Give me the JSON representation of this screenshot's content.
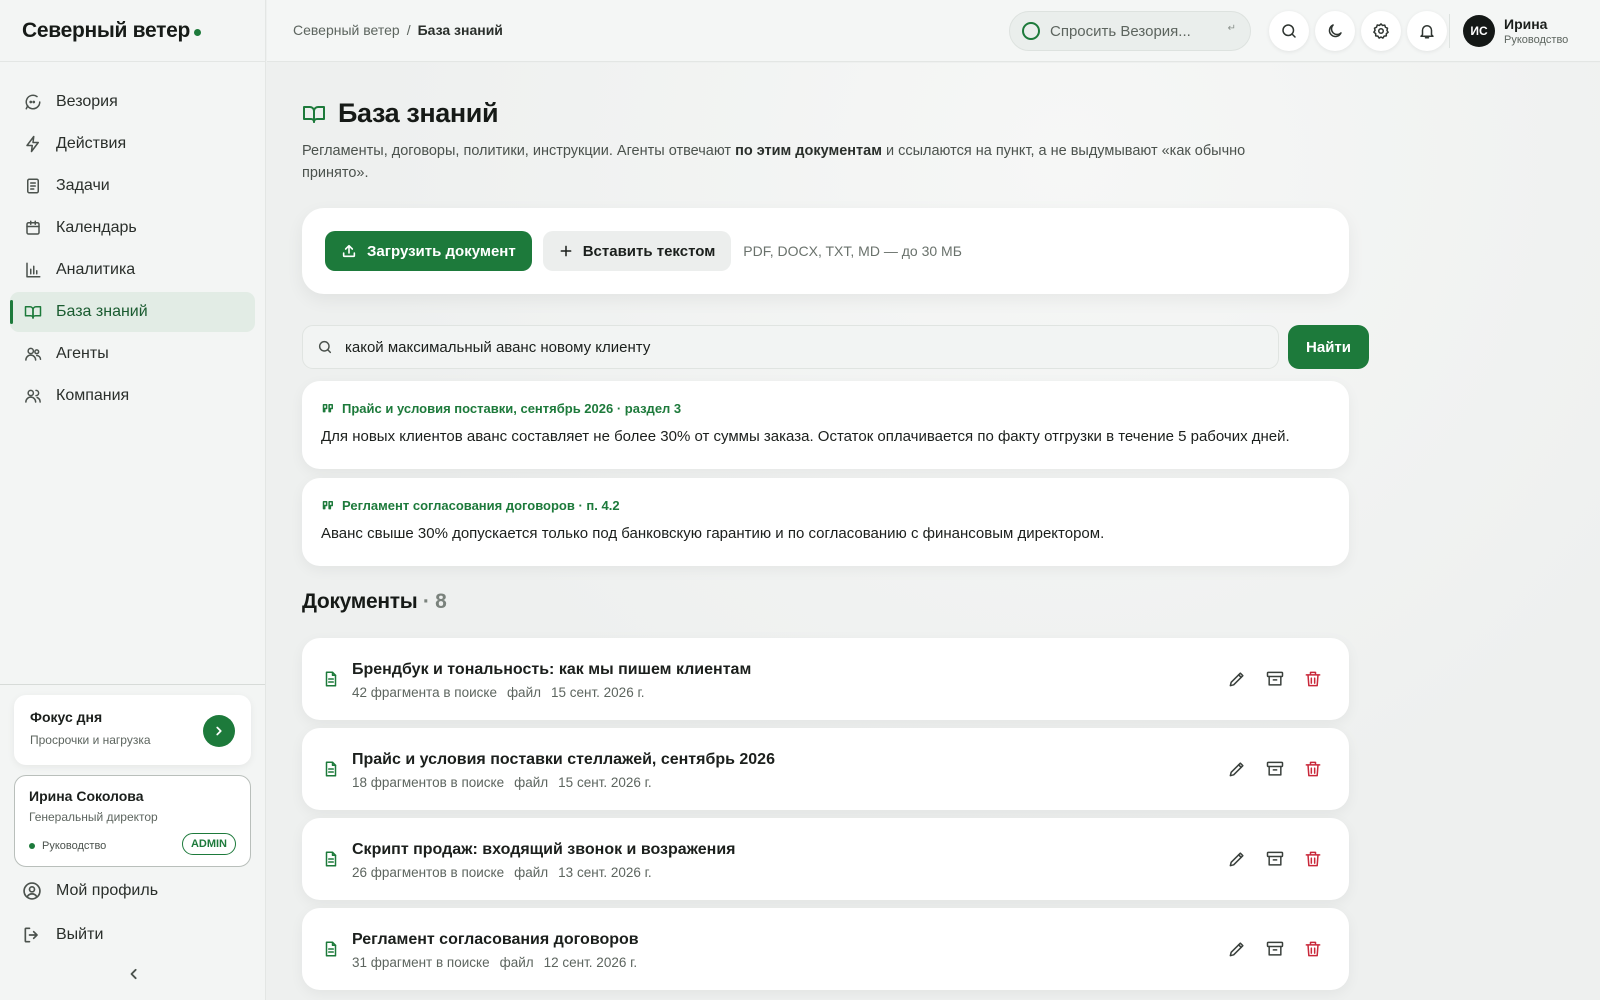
{
  "brand": {
    "name": "Северный ветер"
  },
  "sidebar": {
    "items": [
      {
        "label": "Везория",
        "icon": "chat-icon"
      },
      {
        "label": "Действия",
        "icon": "lightning-icon"
      },
      {
        "label": "Задачи",
        "icon": "tasks-icon"
      },
      {
        "label": "Календарь",
        "icon": "calendar-icon"
      },
      {
        "label": "Аналитика",
        "icon": "bar-chart-icon"
      },
      {
        "label": "База знаний",
        "icon": "book-icon",
        "active": true
      },
      {
        "label": "Агенты",
        "icon": "agents-icon"
      },
      {
        "label": "Компания",
        "icon": "company-icon"
      }
    ],
    "focus": {
      "title": "Фокус дня",
      "subtitle": "Просрочки и нагрузка"
    },
    "user": {
      "name": "Ирина Соколова",
      "position": "Генеральный директор",
      "department": "Руководство",
      "badge": "ADMIN"
    },
    "profile_label": "Мой профиль",
    "logout_label": "Выйти"
  },
  "topbar": {
    "breadcrumb": {
      "root": "Северный ветер",
      "separator": "/",
      "current": "База знаний"
    },
    "ask": {
      "placeholder": "Спросить Везория...",
      "shortcut": "↵"
    },
    "avatar_initials": "ИС",
    "user_name": "Ирина",
    "user_role": "Руководство"
  },
  "page": {
    "title": "База знаний",
    "description_before": "Регламенты, договоры, политики, инструкции. Агенты отвечают ",
    "description_bold": "по этим документам",
    "description_after": " и ссылаются на пункт, а не выдумывают «как обычно принято».",
    "upload_label": "Загрузить документ",
    "paste_label": "Вставить текстом",
    "formats_hint": "PDF, DOCX, TXT, MD — до 30 МБ"
  },
  "search": {
    "query": "какой максимальный аванс новому клиенту",
    "button_label": "Найти",
    "results": [
      {
        "source": "Прайс и условия поставки, сентябрь 2026 · раздел 3",
        "text": "Для новых клиентов аванс составляет не более 30% от суммы заказа. Остаток оплачивается по факту отгрузки в течение 5 рабочих дней."
      },
      {
        "source": "Регламент согласования договоров · п. 4.2",
        "text": "Аванс свыше 30% допускается только под банковскую гарантию и по согласованию с финансовым директором."
      }
    ]
  },
  "documents": {
    "title": "Документы",
    "count_label": "· 8",
    "items": [
      {
        "name": "Брендбук и тональность: как мы пишем клиентам",
        "fragments": "42 фрагмента в поиске",
        "type": "файл",
        "date": "15 сент. 2026 г."
      },
      {
        "name": "Прайс и условия поставки стеллажей, сентябрь 2026",
        "fragments": "18 фрагментов в поиске",
        "type": "файл",
        "date": "15 сент. 2026 г."
      },
      {
        "name": "Скрипт продаж: входящий звонок и возражения",
        "fragments": "26 фрагментов в поиске",
        "type": "файл",
        "date": "13 сент. 2026 г."
      },
      {
        "name": "Регламент согласования договоров",
        "fragments": "31 фрагмент в поиске",
        "type": "файл",
        "date": "12 сент. 2026 г."
      }
    ]
  },
  "colors": {
    "accent": "#1d7a3b",
    "danger": "#c9283a",
    "background": "#eef0ef"
  }
}
